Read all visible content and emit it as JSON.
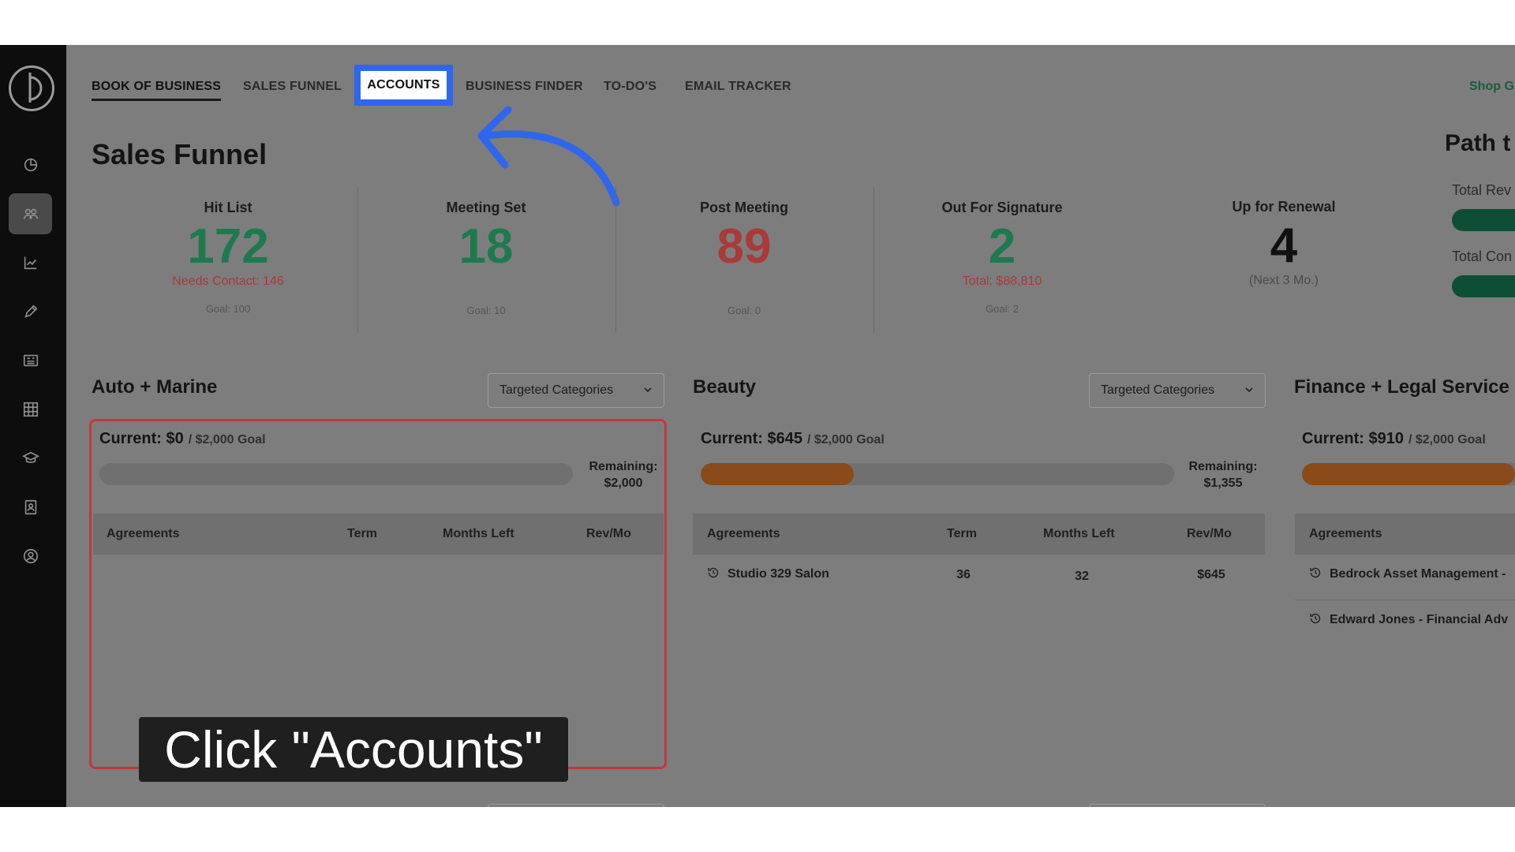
{
  "tabs": [
    {
      "label": "BOOK OF BUSINESS",
      "active": true
    },
    {
      "label": "SALES FUNNEL"
    },
    {
      "label": "ACCOUNTS",
      "highlighted": true
    },
    {
      "label": "BUSINESS FINDER"
    },
    {
      "label": "TO-DO'S"
    },
    {
      "label": "EMAIL TRACKER"
    }
  ],
  "shop_link": "Shop G",
  "page_title": "Sales Funnel",
  "stats": [
    {
      "label": "Hit List",
      "value": "172",
      "sub": "Needs Contact: 146",
      "goal": "Goal: 100"
    },
    {
      "label": "Meeting Set",
      "value": "18",
      "sub": "",
      "goal": "Goal: 10"
    },
    {
      "label": "Post Meeting",
      "value": "89",
      "sub": "",
      "goal": "Goal: 0"
    },
    {
      "label": "Out For Signature",
      "value": "2",
      "sub": "Total: $88,810",
      "goal": "Goal: 2"
    },
    {
      "label": "Up for Renewal",
      "value": "4",
      "sub": "(Next 3 Mo.)",
      "goal": ""
    }
  ],
  "path": {
    "title": "Path t",
    "labels": [
      "Total Rev",
      "Total Con"
    ]
  },
  "categories": [
    {
      "title": "Auto + Marine",
      "select": "Targeted Categories",
      "current": "Current: $0",
      "goal": "/ $2,000 Goal",
      "progress": 0,
      "remaining_label": "Remaining:",
      "remaining_value": "$2,000",
      "headers": [
        "Agreements",
        "Term",
        "Months Left",
        "Rev/Mo"
      ],
      "rows": []
    },
    {
      "title": "Beauty",
      "select": "Targeted Categories",
      "current": "Current: $645",
      "goal": "/ $2,000 Goal",
      "progress": 0.3225,
      "remaining_label": "Remaining:",
      "remaining_value": "$1,355",
      "headers": [
        "Agreements",
        "Term",
        "Months Left",
        "Rev/Mo"
      ],
      "rows": [
        {
          "name": "Studio 329 Salon",
          "term": "36",
          "months_left": "32",
          "rev": "$645"
        }
      ]
    },
    {
      "title": "Finance + Legal Service",
      "current": "Current: $910",
      "goal": "/ $2,000 Goal",
      "progress": 0.455,
      "headers": [
        "Agreements"
      ],
      "rows": [
        {
          "name": "Bedrock Asset Management -"
        },
        {
          "name": "Edward Jones - Financial Adv"
        }
      ]
    }
  ],
  "caption": "Click \"Accounts\"",
  "colors": {
    "accent_green": "#1e7a4e",
    "accent_red": "#a83a3a",
    "highlight_blue": "#2f66ee",
    "progress_fill": "#8a4a1a",
    "box_red": "#c0393c"
  }
}
